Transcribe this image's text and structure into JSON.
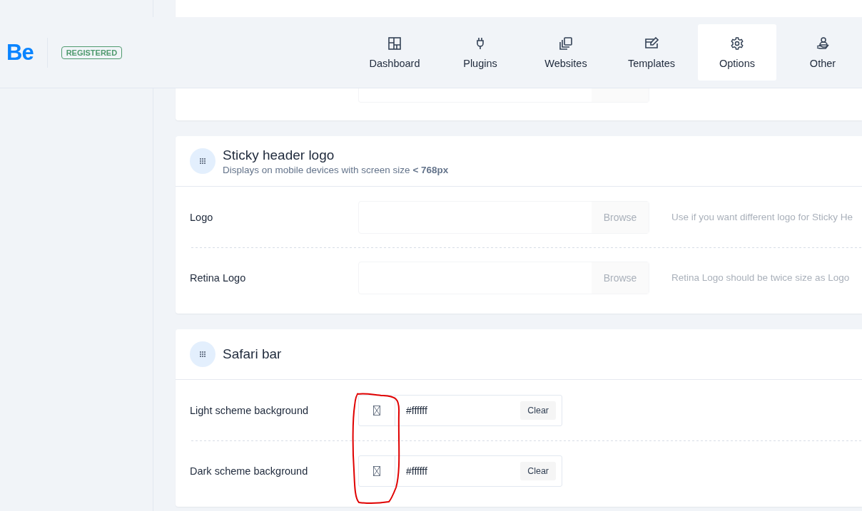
{
  "header": {
    "logo": "Be",
    "badge": "REGISTERED"
  },
  "nav": [
    {
      "label": "Dashboard",
      "selected": false
    },
    {
      "label": "Plugins",
      "selected": false
    },
    {
      "label": "Websites",
      "selected": false
    },
    {
      "label": "Templates",
      "selected": false
    },
    {
      "label": "Options",
      "selected": true
    },
    {
      "label": "Other",
      "selected": false
    }
  ],
  "sections": [
    {
      "title": "Sticky header logo",
      "subtitle": "Displays on mobile devices with screen size **< 768px**",
      "rows": [
        {
          "kind": "upload",
          "label": "Logo",
          "button": "Browse",
          "hint": "Use if you want different logo for Sticky He"
        },
        {
          "kind": "upload",
          "label": "Retina Logo",
          "button": "Browse",
          "hint": "Retina Logo should be twice size as Logo"
        }
      ]
    },
    {
      "title": "Safari bar",
      "rows": [
        {
          "kind": "color",
          "label": "Light scheme background",
          "value": "#ffffff",
          "button": "Clear"
        },
        {
          "kind": "color",
          "label": "Dark scheme background",
          "value": "#ffffff",
          "button": "Clear"
        }
      ]
    }
  ]
}
